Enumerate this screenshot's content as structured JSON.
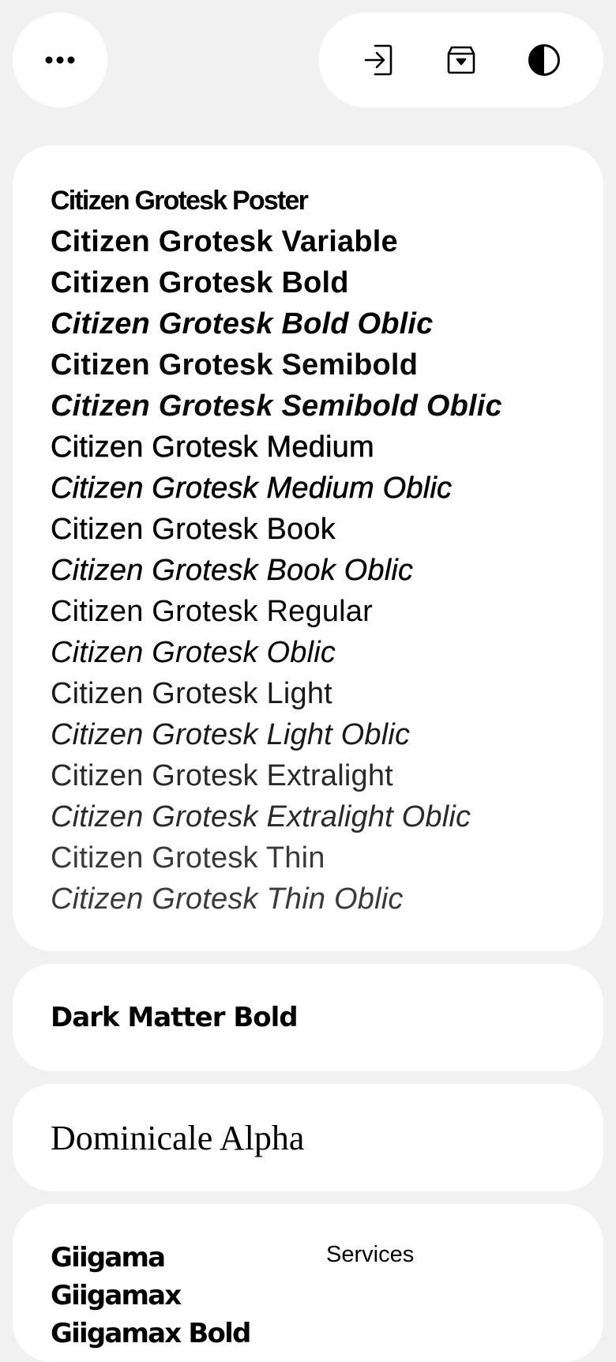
{
  "toolbar": {
    "menu_icon": "more-dots-icon",
    "actions": [
      "login-icon",
      "archive-box-icon",
      "contrast-icon"
    ]
  },
  "citizen": {
    "fonts": [
      "Citizen Grotesk Poster",
      "Citizen Grotesk Variable",
      "Citizen Grotesk Bold",
      "Citizen Grotesk Bold Oblic",
      "Citizen Grotesk Semibold",
      "Citizen Grotesk Semibold Oblic",
      "Citizen Grotesk Medium",
      "Citizen Grotesk Medium Oblic",
      "Citizen Grotesk Book",
      "Citizen Grotesk Book Oblic",
      "Citizen Grotesk Regular",
      "Citizen Grotesk Oblic",
      "Citizen Grotesk Light",
      "Citizen Grotesk Light Oblic",
      "Citizen Grotesk Extralight",
      "Citizen Grotesk Extralight Oblic",
      "Citizen Grotesk Thin",
      "Citizen Grotesk Thin Oblic"
    ]
  },
  "darkmatter": {
    "title": "Dark Matter Bold"
  },
  "dominicale": {
    "title": "Dominicale Alpha"
  },
  "giigamax": {
    "fonts": [
      "Giigama",
      "Giigamax",
      "Giigamax Bold"
    ],
    "services_label": "Services"
  },
  "colors": {
    "background": "#f1f1f1",
    "card": "#ffffff",
    "text": "#000000"
  }
}
